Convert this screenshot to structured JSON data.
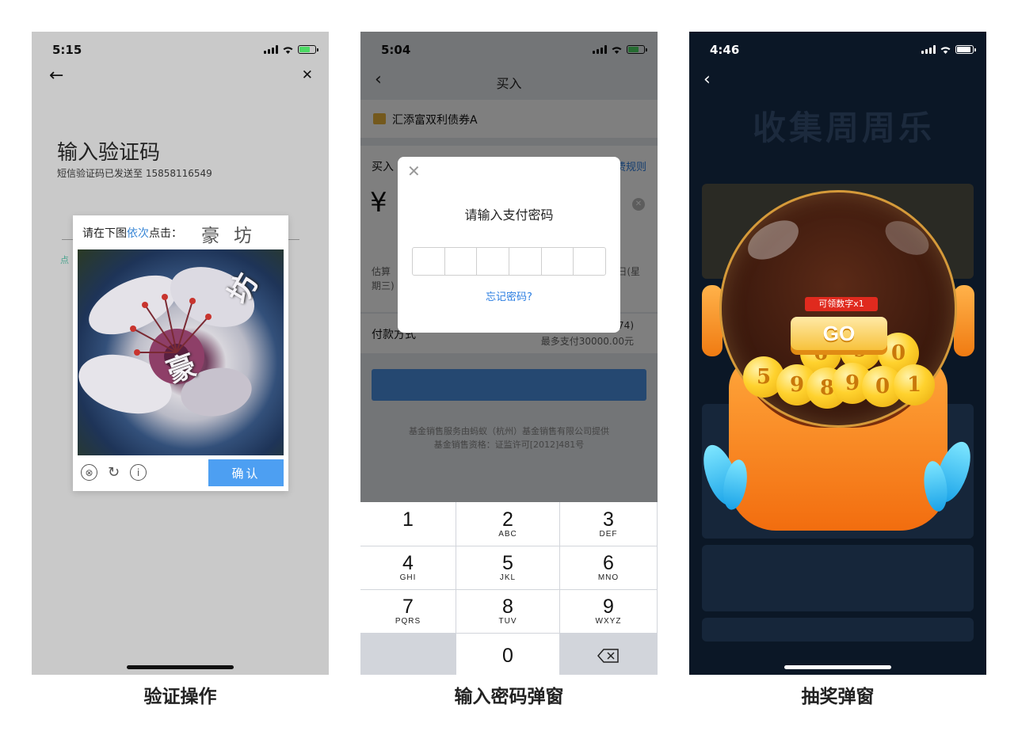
{
  "captions": [
    "验证操作",
    "输入密码弹窗",
    "抽奖弹窗"
  ],
  "phone1": {
    "time": "5:15",
    "title": "输入验证码",
    "subtitle": "短信验证码已发送至 15858116549",
    "hint": "点",
    "captcha": {
      "prompt_before": "请在下图",
      "prompt_highlight": "依次",
      "prompt_after": "点击：",
      "targets": "豪坊",
      "char_a": "坊",
      "char_b": "豪",
      "confirm_label": "确认",
      "tool_close": "⊗",
      "tool_refresh": "↻",
      "tool_info": "i"
    },
    "colors": {
      "background": "#c9c9c9",
      "confirm": "#4d9ff2"
    }
  },
  "phone2": {
    "time": "5:04",
    "nav_title": "买入",
    "fund_name": "汇添富双利债券A",
    "buy_label": "买入",
    "rule_link": "费规则",
    "amount": "¥ 5",
    "estimate_left": "估算",
    "estimate_right": "日(星",
    "estimate_line2": "期三)",
    "pay_label": "付款方式",
    "pay_right1": "74)",
    "pay_right2": "最多支付30000.00元",
    "footer1": "基金销售服务由蚂蚁（杭州）基金销售有限公司提供",
    "footer2": "基金销售资格：证监许可[2012]481号",
    "modal": {
      "title": "请输入支付密码",
      "forgot": "忘记密码?",
      "close": "✕"
    },
    "keypad": [
      {
        "n": "1",
        "l": ""
      },
      {
        "n": "2",
        "l": "ABC"
      },
      {
        "n": "3",
        "l": "DEF"
      },
      {
        "n": "4",
        "l": "GHI"
      },
      {
        "n": "5",
        "l": "JKL"
      },
      {
        "n": "6",
        "l": "MNO"
      },
      {
        "n": "7",
        "l": "PQRS"
      },
      {
        "n": "8",
        "l": "TUV"
      },
      {
        "n": "9",
        "l": "WXYZ"
      },
      {
        "n": "",
        "l": ""
      },
      {
        "n": "0",
        "l": ""
      },
      {
        "n": "⌫",
        "l": ""
      }
    ]
  },
  "phone3": {
    "time": "4:46",
    "bg_title": "收集周周乐",
    "coins": [
      "6",
      "9",
      "0",
      "5",
      "9",
      "8",
      "9",
      "0",
      "1"
    ],
    "tag": "可领数字x1",
    "go_label": "GO",
    "colors": {
      "background": "#0b1726",
      "base": "#f26d0f",
      "tag": "#e02a1e"
    }
  }
}
